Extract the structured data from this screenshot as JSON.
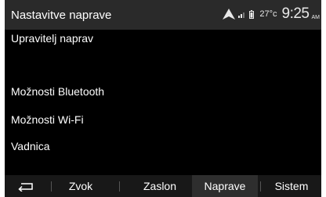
{
  "header": {
    "title": "Nastavitve naprave",
    "status": {
      "icons": [
        "navigation-arrow-icon",
        "signal-bars-icon",
        "battery-icon"
      ],
      "temperature": "27°c",
      "time": "9:25",
      "ampm": "AM"
    }
  },
  "menu": {
    "items": [
      {
        "label": "Upravitelj naprav"
      },
      {
        "label": "Možnosti Bluetooth"
      },
      {
        "label": "Možnosti Wi-Fi"
      },
      {
        "label": "Vadnica"
      }
    ]
  },
  "tabbar": {
    "back_icon": "back-arrow-icon",
    "tabs": [
      {
        "label": "Zvok"
      },
      {
        "label": "Zaslon"
      },
      {
        "label": "Naprave",
        "active": true
      },
      {
        "label": "Sistem"
      }
    ]
  },
  "colors": {
    "background": "#000000",
    "header": "#2a2a2a",
    "active_tab": "#2e2e2e",
    "text": "#ffffff"
  }
}
